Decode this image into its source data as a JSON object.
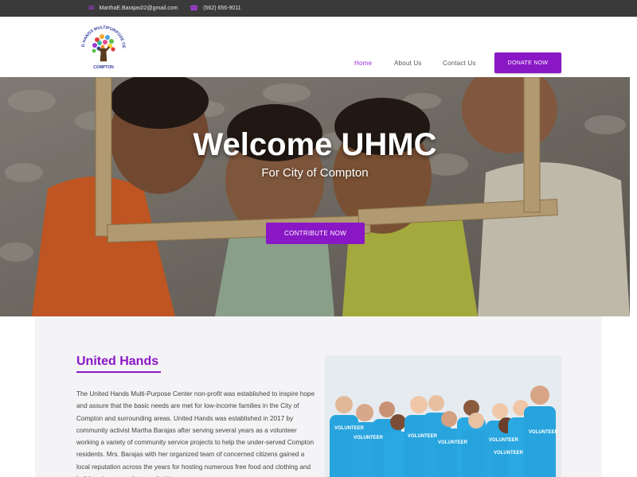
{
  "topbar": {
    "email": "MarthaE.Barajas02@gmail.com",
    "phone": "(562) 656-9011",
    "email_icon": "envelope-icon",
    "phone_icon": "phone-icon"
  },
  "logo": {
    "arc_text": "UNITED HANDS MULTIPURPOSE CENTER",
    "bottom_text": "COMPTON"
  },
  "nav": {
    "items": [
      {
        "label": "Home",
        "active": true
      },
      {
        "label": "About Us",
        "active": false
      },
      {
        "label": "Contact Us",
        "active": false
      }
    ],
    "donate_label": "DONATE NOW"
  },
  "hero": {
    "title": "Welcome UHMC",
    "subtitle": "For City of Compton",
    "button_label": "CONTRIBUTE NOW"
  },
  "about": {
    "title": "United Hands",
    "body": "The United Hands Multi-Purpose Center non-profit was established to inspire hope and assure that the basic needs are met for low-income families in the City of Compton and surrounding areas. United Hands was established in 2017 by community activist Martha Barajas after serving several years as a volunteer working a variety of community service projects to help the under-served Compton residents. Mrs. Barajas with her organized team of concerned citizens gained a local reputation across the years for hosting numerous free food and clothing and holiday giveaways that resulted in",
    "shirt_text": "VOLUNTEER"
  },
  "colors": {
    "accent": "#8a17c6",
    "topbar": "#3a3a3a",
    "section_bg": "#f4f3f5"
  }
}
